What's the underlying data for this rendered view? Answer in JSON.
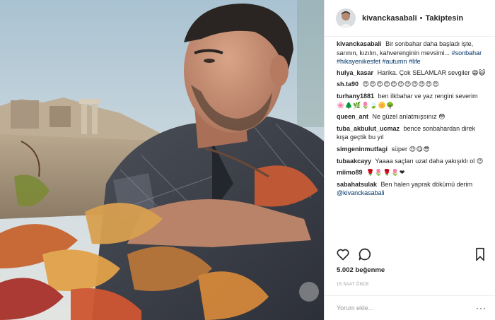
{
  "header": {
    "username": "kivanckasabali",
    "separator": "•",
    "follow_status": "Takiptesin"
  },
  "caption": {
    "username": "kivanckasabali",
    "text": "Bir sonbahar daha başladı işte, sarının, kızılın, kahverenginin mevsimi...",
    "hashtags": "#sonbahar #hikayenikesfet #autumn #life"
  },
  "comments": [
    {
      "user": "hulya_kasar",
      "text": "Harika. Çok SELAMLAR sevgiler",
      "emoji": "😁😺"
    },
    {
      "user": "sh.ta90",
      "text": "",
      "emoji": "😍😍😍😍😍😍😍😍😍😍😍"
    },
    {
      "user": "turhany1881",
      "text": "ben ilkbahar ve yaz rengini severim",
      "emoji": "🌸🌲🌿🌷🍃🌼🌳"
    },
    {
      "user": "queen_ant",
      "text": "Ne güzel anlatmışsınız",
      "emoji": "😳"
    },
    {
      "user": "tuba_akbulut_ucmaz",
      "text": "bence sonbahardan direk kışa geçtik bu yıl",
      "emoji": ""
    },
    {
      "user": "simgeninmutfagi",
      "text": "süper",
      "emoji": "😍😋😎"
    },
    {
      "user": "tubaakcayy",
      "text": "Yaaaa saçları uzat daha yakışıklı ol",
      "emoji": "😍"
    },
    {
      "user": "miimo89",
      "text": "",
      "emoji": "🌹🌷🌹🌷❤"
    },
    {
      "user": "sabahatsulak",
      "text": "Ben halen yaprak dökümü derim",
      "mention": "@kivanckasabali",
      "emoji": ""
    }
  ],
  "actions": {
    "like_icon": "heart-icon",
    "comment_icon": "comment-bubble-icon",
    "save_icon": "bookmark-icon"
  },
  "likes": "5.002 beğenme",
  "timestamp": "15 SAAT ÖNCE",
  "add_comment": {
    "placeholder": "Yorum ekle...",
    "more_label": "···"
  },
  "colors": {
    "text": "#262626",
    "link": "#003569",
    "muted": "#999999",
    "border": "#efefef"
  }
}
